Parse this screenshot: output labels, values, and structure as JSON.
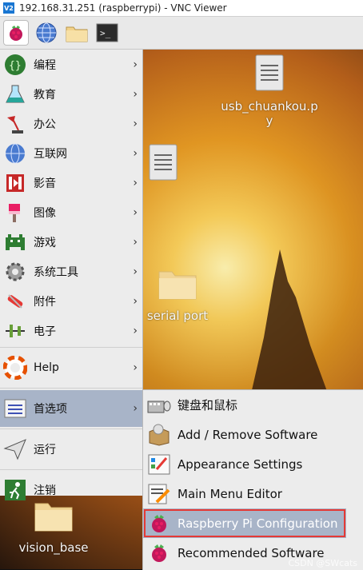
{
  "window": {
    "title": "192.168.31.251 (raspberrypi) - VNC Viewer",
    "logo_text": "V2"
  },
  "taskbar": {
    "buttons": [
      {
        "name": "raspberry-menu-button",
        "icon": "raspberry-icon"
      },
      {
        "name": "browser-button",
        "icon": "globe-icon"
      },
      {
        "name": "file-manager-button",
        "icon": "folder-icon"
      },
      {
        "name": "terminal-button",
        "icon": "terminal-icon",
        "glyph": ">_"
      }
    ]
  },
  "desktop": {
    "icons": [
      {
        "label": "usb_chuankou.p\ny",
        "icon": "text-file-icon"
      },
      {
        "label": "",
        "icon": "text-file-icon"
      },
      {
        "label": "serial port",
        "icon": "folder-icon"
      },
      {
        "label": "vision_base",
        "icon": "folder-icon"
      }
    ],
    "watermark": "CSDN @SWcats"
  },
  "menu": {
    "items": [
      {
        "label": "编程",
        "icon": "programming-icon"
      },
      {
        "label": "教育",
        "icon": "education-icon"
      },
      {
        "label": "办公",
        "icon": "office-icon"
      },
      {
        "label": "互联网",
        "icon": "internet-icon"
      },
      {
        "label": "影音",
        "icon": "sound-video-icon"
      },
      {
        "label": "图像",
        "icon": "graphics-icon"
      },
      {
        "label": "游戏",
        "icon": "games-icon"
      },
      {
        "label": "系统工具",
        "icon": "system-tools-icon"
      },
      {
        "label": "附件",
        "icon": "accessories-icon"
      },
      {
        "label": "电子",
        "icon": "electronics-icon"
      },
      {
        "label": "Help",
        "icon": "help-icon"
      },
      {
        "label": "首选项",
        "icon": "preferences-icon"
      },
      {
        "label": "运行",
        "icon": "run-icon"
      },
      {
        "label": "注销",
        "icon": "logout-icon"
      }
    ]
  },
  "submenu": {
    "items": [
      {
        "label": "键盘和鼠标",
        "icon": "keyboard-mouse-icon"
      },
      {
        "label": "Add / Remove Software",
        "icon": "add-remove-software-icon"
      },
      {
        "label": "Appearance Settings",
        "icon": "appearance-settings-icon"
      },
      {
        "label": "Main Menu Editor",
        "icon": "menu-editor-icon"
      },
      {
        "label": "Raspberry Pi Configuration",
        "icon": "raspberry-icon"
      },
      {
        "label": "Recommended Software",
        "icon": "raspberry-icon"
      }
    ]
  },
  "colors": {
    "selection": "#a8b4c8",
    "highlight_border": "#e53935",
    "menu_bg": "#ececec"
  }
}
